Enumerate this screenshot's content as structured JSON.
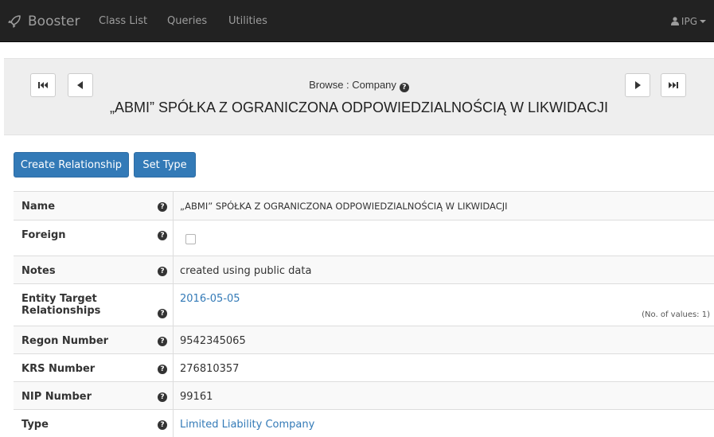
{
  "navbar": {
    "brand": "Booster",
    "links": [
      "Class List",
      "Queries",
      "Utilities"
    ],
    "user": "IPG"
  },
  "browse": {
    "label": "Browse : Company",
    "title": "„ABMI” SPÓŁKA Z OGRANICZONA ODPOWIEDZIALNOŚCIĄ W LIKWIDACJI"
  },
  "actions": {
    "create_relationship": "Create Relationship",
    "set_type": "Set Type"
  },
  "properties": [
    {
      "label": "Name",
      "value": "„ABMI” SPÓŁKA Z OGRANICZONA ODPOWIEDZIALNOŚCIĄ W LIKWIDACJI"
    },
    {
      "label": "Foreign",
      "value": "",
      "checked": false
    },
    {
      "label": "Notes",
      "value": "created using public data"
    },
    {
      "label": "Entity Target Relationships",
      "value": "2016-05-05",
      "count_note": "(No. of values: 1)"
    },
    {
      "label": "Regon Number",
      "value": "9542345065"
    },
    {
      "label": "KRS Number",
      "value": "276810357"
    },
    {
      "label": "NIP Number",
      "value": "99161"
    },
    {
      "label": "Type",
      "value": "Limited Liability Company"
    }
  ],
  "colors": {
    "navbar_bg": "#222222",
    "primary": "#337ab7",
    "link": "#337ab7"
  },
  "icons": {
    "brand": "rocket-icon",
    "user": "user-icon",
    "help": "question-circle-icon",
    "first": "step-backward-icon",
    "prev": "triangle-left-icon",
    "next": "triangle-right-icon",
    "last": "step-forward-icon"
  }
}
